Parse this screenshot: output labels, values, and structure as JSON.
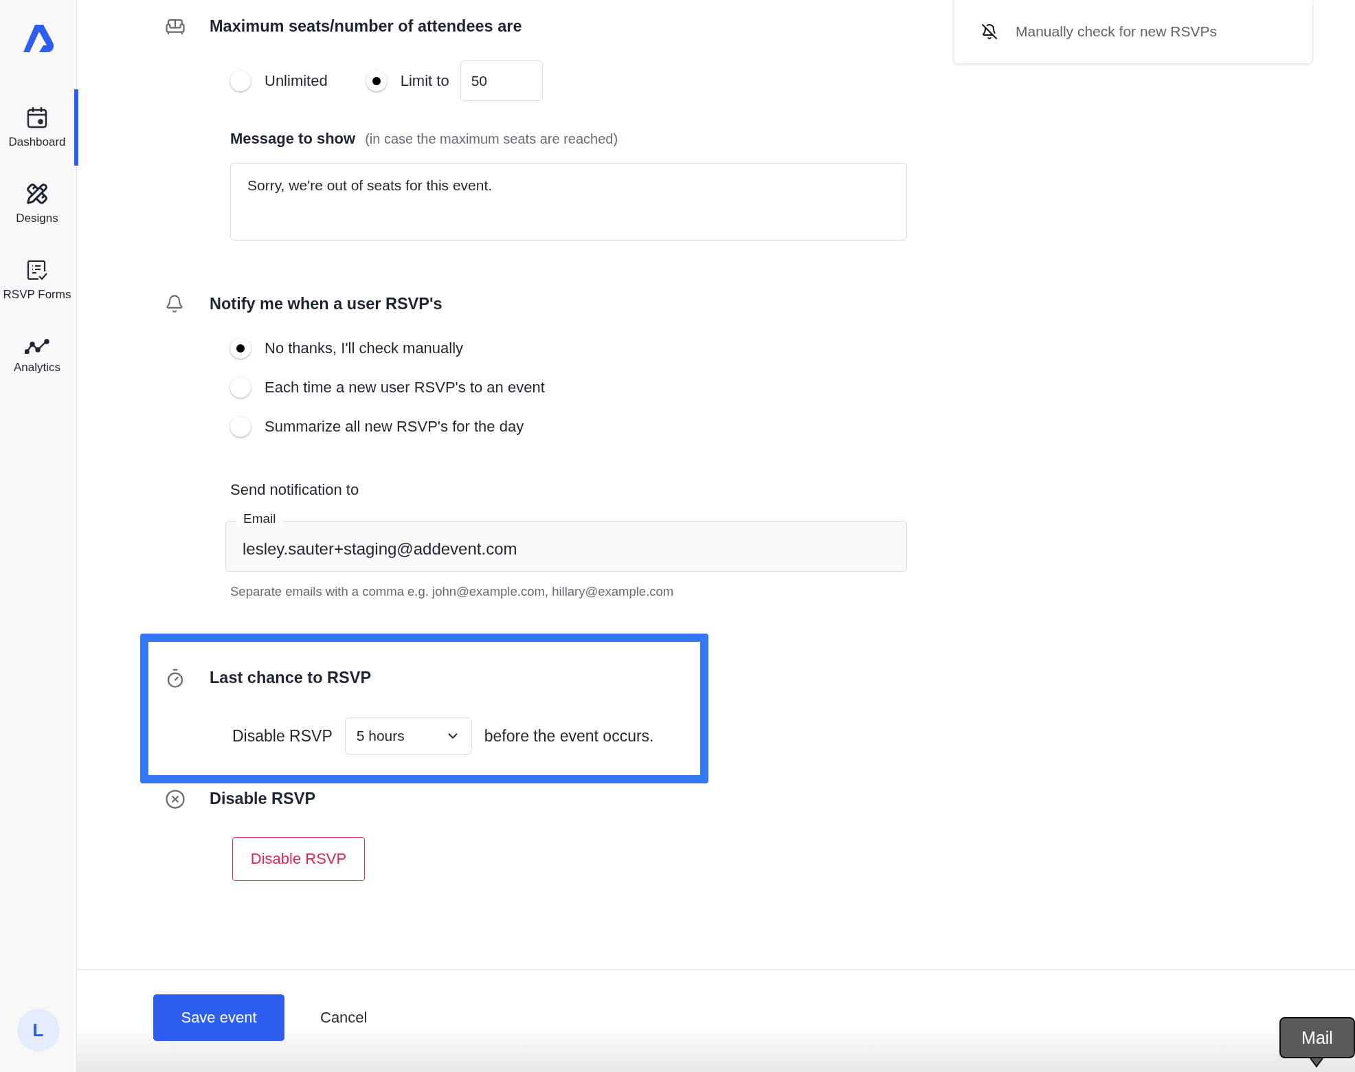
{
  "sidebar": {
    "items": [
      {
        "label": "Dashboard",
        "selected": true
      },
      {
        "label": "Designs",
        "selected": false
      },
      {
        "label": "RSVP Forms",
        "selected": false
      },
      {
        "label": "Analytics",
        "selected": false
      }
    ],
    "avatar": "L"
  },
  "sections": [
    {
      "kind": "seats",
      "title": "Maximum seats/number of attendees are",
      "highlighted": false,
      "options": [
        {
          "label": "Unlimited",
          "selected": false
        },
        {
          "label": "Limit to",
          "selected": true
        }
      ],
      "limit_value": "50",
      "message_label": "Message to show",
      "message_hint": "(in case the maximum seats are reached)",
      "message_value": "Sorry, we're out of seats for this event."
    },
    {
      "kind": "notify",
      "title": "Notify me when a user RSVP's",
      "highlighted": false,
      "options": [
        {
          "label": "No thanks, I'll check manually",
          "selected": true
        },
        {
          "label": "Each time a new user RSVP's to an event",
          "selected": false
        },
        {
          "label": "Summarize all new RSVP's for the day",
          "selected": false
        }
      ],
      "send_label": "Send notification to",
      "email_label": "Email",
      "email_value": "lesley.sauter+staging@addevent.com",
      "helper": "Separate emails with a comma e.g. john@example.com, hillary@example.com"
    },
    {
      "kind": "deadline",
      "title": "Last chance to RSVP",
      "highlighted": true,
      "prefix": "Disable RSVP",
      "select_value": "5 hours",
      "suffix": "before the event occurs."
    },
    {
      "kind": "disable",
      "title": "Disable RSVP",
      "highlighted": false,
      "button": "Disable RSVP"
    }
  ],
  "summary_card": {
    "text": "Manually check for new RSVPs"
  },
  "footer": {
    "save": "Save event",
    "cancel": "Cancel"
  },
  "tooltip": "Mail"
}
